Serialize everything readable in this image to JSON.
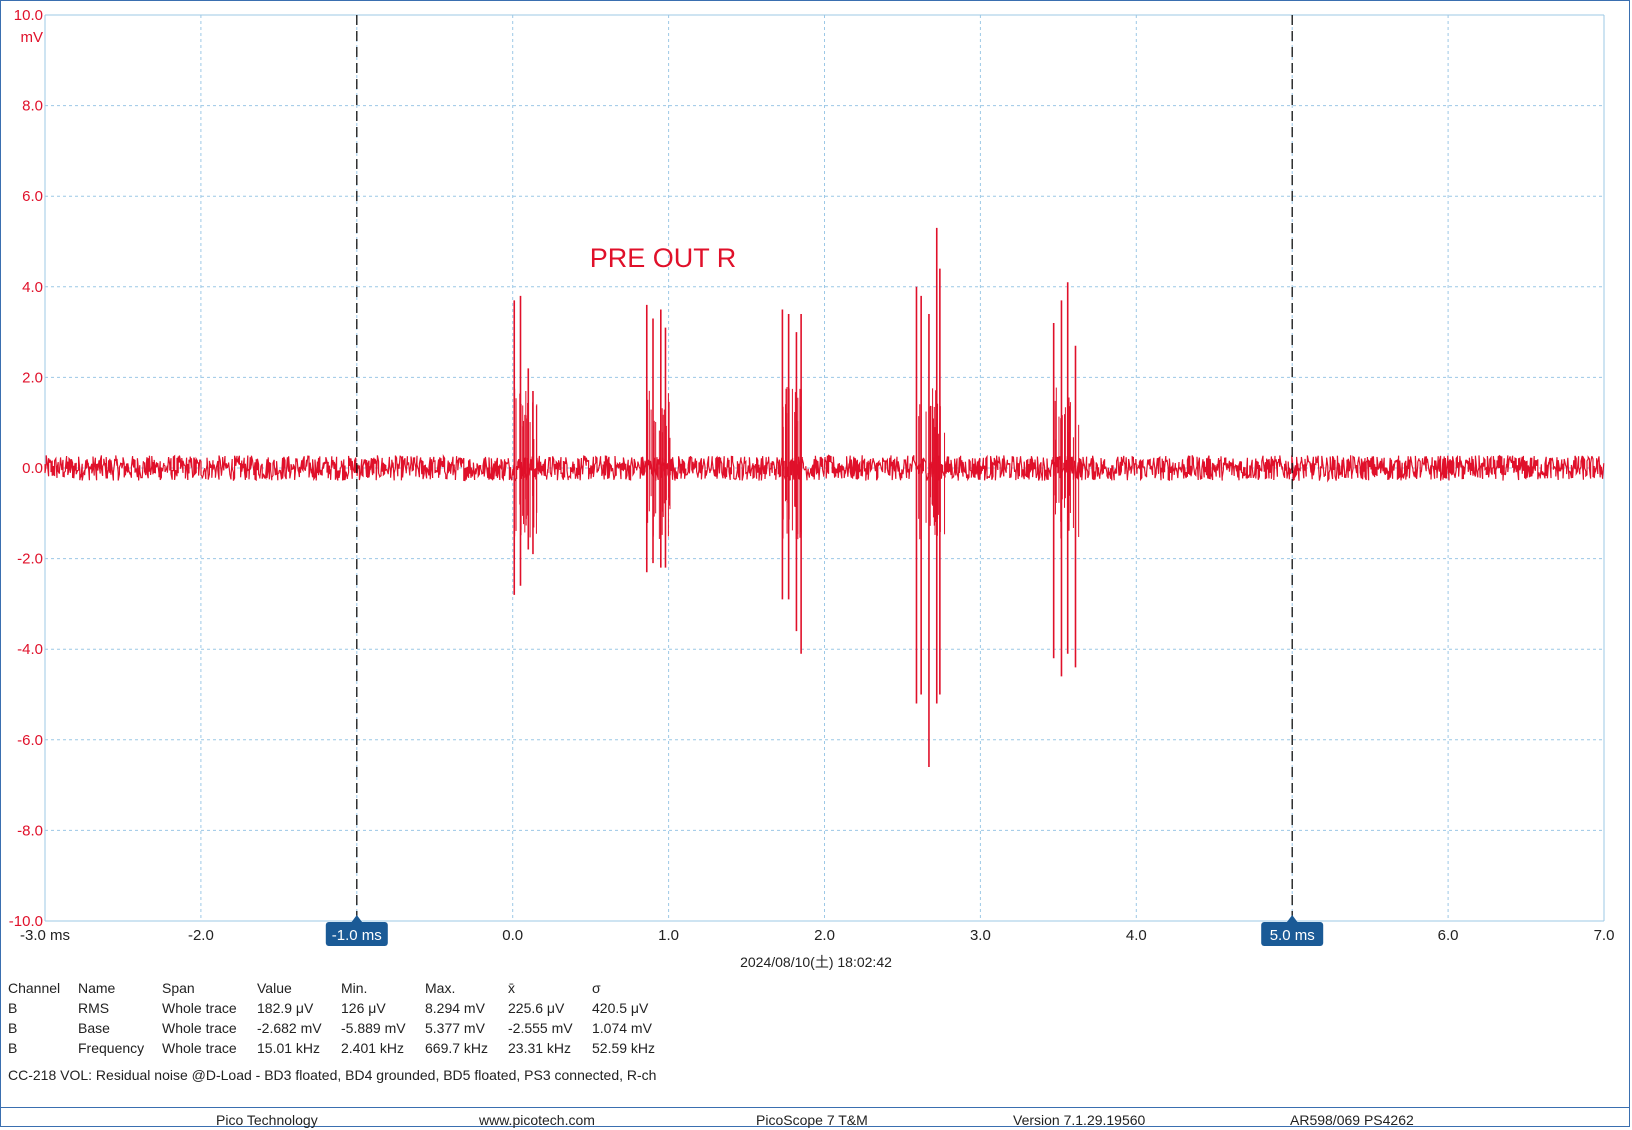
{
  "chart_data": {
    "type": "line",
    "title": "PRE OUT R",
    "xlabel": "",
    "ylabel": "",
    "yunit": "mV",
    "xlim": [
      -3.0,
      7.0
    ],
    "ylim": [
      -10.0,
      10.0
    ],
    "grid": true,
    "y_ticks": [
      "10.0",
      "8.0",
      "6.0",
      "4.0",
      "2.0",
      "0.0",
      "-2.0",
      "-4.0",
      "-6.0",
      "-8.0",
      "-10.0"
    ],
    "x_ticks": [
      "-3.0 ms",
      "-2.0",
      "-1.0",
      "0.0",
      "1.0",
      "2.0",
      "3.0",
      "4.0",
      "5.0",
      "6.0",
      "7.0"
    ],
    "noise_band_mv": [
      -0.4,
      0.4
    ],
    "series": [
      {
        "color": "#e0102a",
        "bursts": [
          {
            "x_ms": 0.02,
            "pos_mv": [
              3.7,
              3.8,
              2.2,
              1.7
            ],
            "neg_mv": [
              -2.8,
              -2.6,
              -1.8,
              -1.9
            ],
            "spikes_x_ms": [
              0.01,
              0.05,
              0.1,
              0.13
            ]
          },
          {
            "x_ms": 0.87,
            "pos_mv": [
              3.6,
              3.3,
              3.5,
              3.1
            ],
            "neg_mv": [
              -2.3,
              -2.1,
              -2.2,
              -2.2
            ],
            "spikes_x_ms": [
              0.86,
              0.9,
              0.95,
              0.98
            ]
          },
          {
            "x_ms": 1.73,
            "pos_mv": [
              3.5,
              3.4,
              3.0,
              3.4
            ],
            "neg_mv": [
              -2.9,
              -2.9,
              -3.6,
              -4.1
            ],
            "spikes_x_ms": [
              1.73,
              1.77,
              1.82,
              1.85
            ]
          },
          {
            "x_ms": 2.58,
            "pos_mv": [
              4.0,
              3.8,
              3.4,
              5.3,
              4.4
            ],
            "neg_mv": [
              -5.2,
              -5.0,
              -6.6,
              -5.2,
              -5.0
            ],
            "spikes_x_ms": [
              2.59,
              2.62,
              2.67,
              2.72,
              2.74
            ]
          },
          {
            "x_ms": 3.49,
            "pos_mv": [
              3.2,
              3.7,
              4.1,
              2.7
            ],
            "neg_mv": [
              -4.2,
              -4.6,
              -4.1,
              -4.4
            ],
            "spikes_x_ms": [
              3.47,
              3.52,
              3.56,
              3.61
            ]
          }
        ]
      }
    ],
    "cursors": [
      {
        "x_ms": -1.0,
        "label": "-1.0 ms"
      },
      {
        "x_ms": 5.0,
        "label": "5.0 ms"
      }
    ]
  },
  "timestamp": "2024/08/10(土) 18:02:42",
  "measurements": {
    "headers": [
      "Channel",
      "Name",
      "Span",
      "Value",
      "Min.",
      "Max.",
      "x̄",
      "σ"
    ],
    "rows": [
      [
        "B",
        "RMS",
        "Whole trace",
        "182.9 μV",
        "126 μV",
        "8.294 mV",
        "225.6 μV",
        "420.5 μV"
      ],
      [
        "B",
        "Base",
        "Whole trace",
        "-2.682 mV",
        "-5.889 mV",
        "5.377 mV",
        "-2.555 mV",
        "1.074 mV"
      ],
      [
        "B",
        "Frequency",
        "Whole trace",
        "15.01 kHz",
        "2.401 kHz",
        "669.7 kHz",
        "23.31 kHz",
        "52.59 kHz"
      ]
    ]
  },
  "caption": "CC-218 VOL: Residual noise @D-Load - BD3 floated, BD4 grounded, BD5 floated, PS3 connected, R-ch",
  "footer": {
    "company": "Pico Technology",
    "website": "www.picotech.com",
    "product": "PicoScope 7 T&M",
    "version": "Version 7.1.29.19560",
    "device": "AR598/069 PS4262"
  }
}
